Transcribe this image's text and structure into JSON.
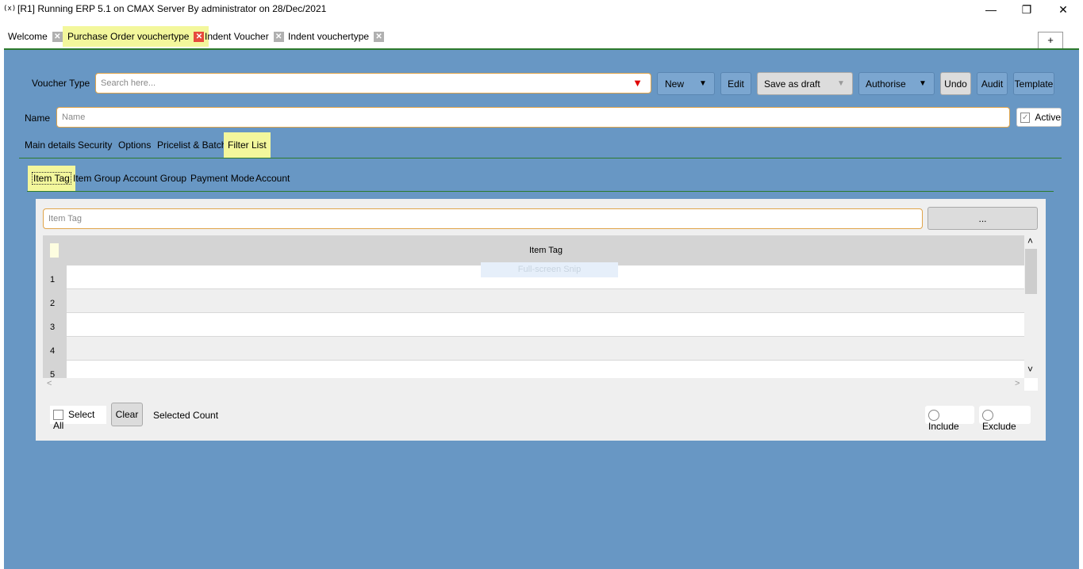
{
  "window": {
    "icon": "(x)",
    "title": "[R1] Running ERP 5.1 on CMAX Server By administrator on 28/Dec/2021",
    "minimize": "—",
    "restore": "❐",
    "close": "✕"
  },
  "tabs": [
    {
      "label": "Welcome",
      "close": "✕"
    },
    {
      "label": "Purchase Order vouchertype",
      "close": "✕"
    },
    {
      "label": "Indent Voucher",
      "close": "✕"
    },
    {
      "label": "Indent vouchertype",
      "close": "✕"
    }
  ],
  "add_tab": "+",
  "header": {
    "voucher_type_label": "Voucher Type",
    "search_placeholder": "Search here...",
    "new_label": "New",
    "edit_label": "Edit",
    "save_draft_label": "Save as draft",
    "authorise_label": "Authorise",
    "undo_label": "Undo",
    "audit_label": "Audit",
    "template_label": "Template",
    "dropdown_arrow": "▼"
  },
  "name_row": {
    "label": "Name",
    "placeholder": "Name",
    "active_label": "Active",
    "active_check": "✓"
  },
  "section_tabs": [
    "Main details",
    "Security",
    "Options",
    "Pricelist & Batch",
    "Filter List"
  ],
  "filter_tabs": [
    "Item Tag",
    "Item Group",
    "Account Group",
    "Payment Mode",
    "Account"
  ],
  "filter": {
    "item_tag_placeholder": "Item Tag",
    "browse_label": "...",
    "column_header": "Item Tag",
    "rows": [
      "1",
      "2",
      "3",
      "4",
      "5"
    ],
    "overlay_text": "Full-screen Snip",
    "scroll_up": "˄",
    "scroll_down": "˅",
    "scroll_left": "<",
    "scroll_right": ">"
  },
  "footer": {
    "select_all_label": "Select All",
    "clear_label": "Clear",
    "selected_count_label": "Selected Count",
    "include_label": "Include",
    "exclude_label": "Exclude"
  },
  "colors": {
    "panel_blue": "#6897c4",
    "highlight_yellow": "#f3f79c",
    "close_red": "#e64a3c",
    "dropdown_red": "#e00000"
  }
}
